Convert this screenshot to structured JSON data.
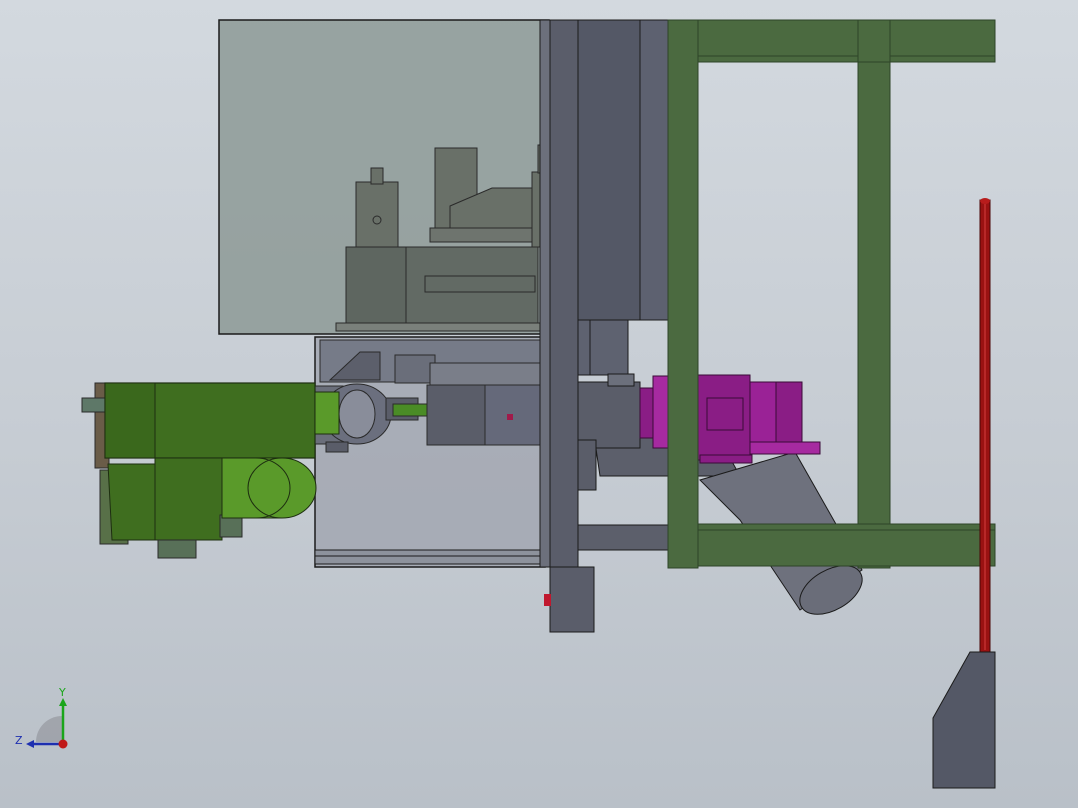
{
  "viewport": {
    "background_top": "#d3d9df",
    "background_bottom": "#b9c0c8"
  },
  "colors": {
    "frame_green": "#4b6a40",
    "frame_green_dark": "#2e4428",
    "motor_green": "#3f6e1f",
    "motor_green_light": "#5a9a2a",
    "housing_gray": "#545866",
    "housing_gray_light": "#6e7280",
    "glass_box": "#8d9a96",
    "motor_magenta": "#8a1d85",
    "motor_magenta_light": "#a62aa0",
    "rod_red": "#9a1212",
    "pipe_gray": "#5c5f6b"
  },
  "triad": {
    "y_label": "Y",
    "z_label": "Z",
    "y_color": "#1aa51a",
    "z_color": "#1e2fb0",
    "x_color": "#c01818"
  }
}
